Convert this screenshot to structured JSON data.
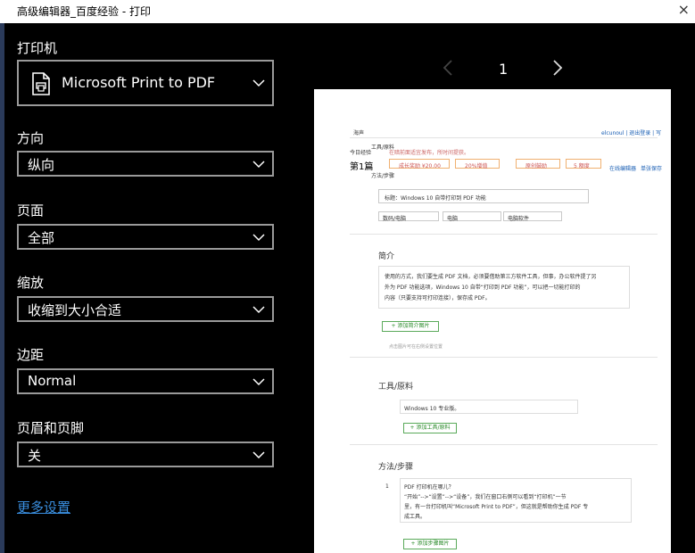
{
  "window": {
    "title": "高级编辑器_百度经验 - 打印",
    "close": "×"
  },
  "printer": {
    "label": "打印机",
    "value": "Microsoft Print to PDF"
  },
  "orientation": {
    "label": "方向",
    "value": "纵向"
  },
  "pages": {
    "label": "页面",
    "value": "全部"
  },
  "scale": {
    "label": "缩放",
    "value": "收缩到大小合适"
  },
  "margins": {
    "label": "边距",
    "value": "Normal"
  },
  "headers": {
    "label": "页眉和页脚",
    "value": "关"
  },
  "more_settings": "更多设置",
  "preview": {
    "page_number": "1",
    "doc": {
      "top_link": "海声",
      "top_right": "elcunoul | 退出登录 | 写",
      "left_lines": [
        "今日经验",
        "第1篇",
        "工具/原料",
        "方法/步骤"
      ],
      "notice": "在暗前面适宜发布，所时间提获。",
      "chips": [
        "成长奖励 ¥20.00",
        "20%增值",
        "原创鼓励",
        "5 额度"
      ],
      "right_links": [
        "在线编辑器",
        "单张保存"
      ],
      "title_input": "标题：Windows 10 自带打印到 PDF 功能",
      "selects": [
        "数码/电脑",
        "电脑",
        "电脑软件"
      ],
      "intro_heading": "简介",
      "intro_text": [
        "使用的方式，我们要生成 PDF 文档，必须要借助第三方软件工具，但事，办公软件提了另",
        "外为 PDF 功能选项，Windows 10 自带“打印到 PDF 功能”，可以把一切能打印的",
        "内容（只要支持可打印连接），保存成 PDF。"
      ],
      "add_image_btn": "+ 添加简介图片",
      "add_image_hint": "点击图片可在右侧设置位置",
      "tools_heading": "工具/原料",
      "tools_text": "Windows 10 专业版。",
      "add_tool_btn": "+ 添加工具/原料",
      "steps_heading": "方法/步骤",
      "step_num": "1",
      "step_title": "PDF 打印机在哪儿？",
      "step_text": [
        "“开始”-->“设置”-->“设备”，我们在窗口右侧可以看到“打印机”一节",
        "里，有一台打印机叫“Microsoft Print to PDF”，但这就是帮助你生成 PDF 专",
        "成工具。"
      ],
      "add_step_btn": "+ 添加步骤图片"
    }
  }
}
